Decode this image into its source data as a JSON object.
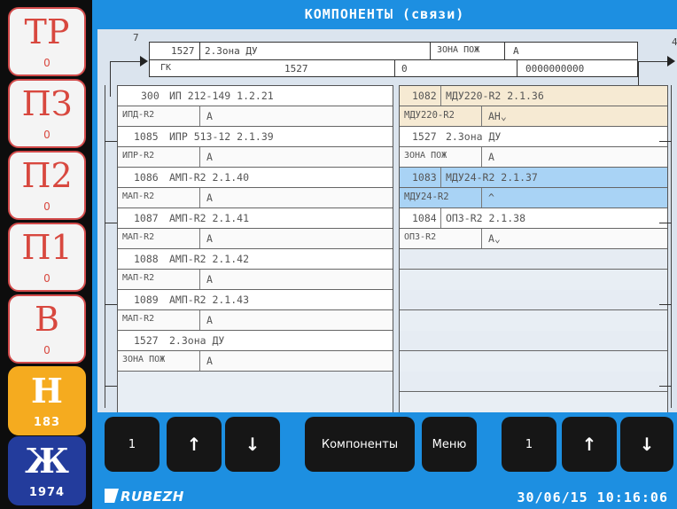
{
  "sidebar": {
    "buttons": [
      {
        "label": "ТР",
        "count": "0"
      },
      {
        "label": "ПЗ",
        "count": "0"
      },
      {
        "label": "П2",
        "count": "0"
      },
      {
        "label": "П1",
        "count": "0"
      },
      {
        "label": "В",
        "count": "0"
      },
      {
        "label": "Н",
        "count": "183"
      },
      {
        "label": "Ж",
        "count": "1974"
      }
    ]
  },
  "title": "КОМПОНЕНТЫ (связи)",
  "header": {
    "left_index": "7",
    "right_index": "4",
    "id": "1527",
    "name": "2.Зона ДУ",
    "zone_label": "ЗОНА ПОЖ",
    "zone_value": "А",
    "type": "ГК",
    "num": "1527",
    "zero": "0",
    "code": "0000000000"
  },
  "left_list": [
    {
      "id": "300",
      "name": "ИП 212-149 1.2.21",
      "type": "ИПД-R2",
      "state": "А"
    },
    {
      "id": "1085",
      "name": "ИПР 513-12 2.1.39",
      "type": "ИПР-R2",
      "state": "А"
    },
    {
      "id": "1086",
      "name": "АМП-R2 2.1.40",
      "type": "МАП-R2",
      "state": "А"
    },
    {
      "id": "1087",
      "name": "АМП-R2 2.1.41",
      "type": "МАП-R2",
      "state": "А"
    },
    {
      "id": "1088",
      "name": "АМП-R2 2.1.42",
      "type": "МАП-R2",
      "state": "А"
    },
    {
      "id": "1089",
      "name": "АМП-R2 2.1.43",
      "type": "МАП-R2",
      "state": "А"
    },
    {
      "id": "1527",
      "name": "2.Зона ДУ",
      "type": "ЗОНА ПОЖ",
      "state": "А"
    }
  ],
  "right_list": [
    {
      "id": "1082",
      "name": "МДУ220-R2 2.1.36",
      "type": "МДУ220-R2",
      "state": "АН⌄",
      "highlight": "#f6ead3"
    },
    {
      "id": "1527",
      "name": "2.Зона ДУ",
      "type": "ЗОНА ПОЖ",
      "state": "А",
      "highlight": "#ffffff"
    },
    {
      "id": "1083",
      "name": "МДУ24-R2 2.1.37",
      "type": "МДУ24-R2",
      "state": "^",
      "highlight": "#a9d3f5"
    },
    {
      "id": "1084",
      "name": "ОПЗ-R2 2.1.38",
      "type": "ОПЗ-R2",
      "state": "А⌄",
      "highlight": "#ffffff"
    }
  ],
  "toolbar": {
    "left_page": "1",
    "up": "↑",
    "down": "↓",
    "components": "Компоненты",
    "menu": "Меню",
    "right_page": "1"
  },
  "status": {
    "logo": "RUBEZH",
    "datetime": "30/06/15 10:16:06"
  }
}
